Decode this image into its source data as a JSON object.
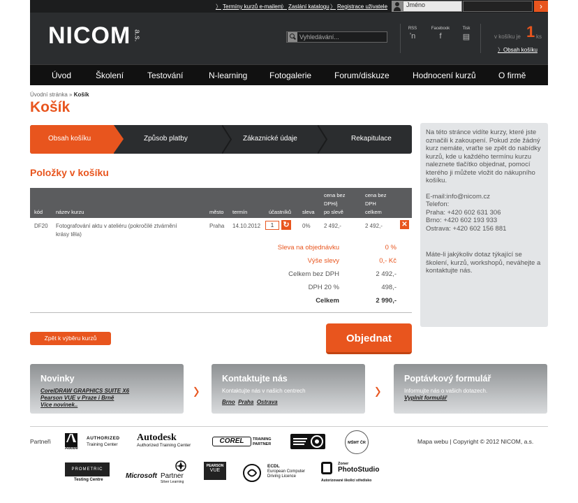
{
  "topbar": {
    "links": [
      "Termíny kurzů e-mailem",
      "Zaslání katalogu",
      "Registrace uživatele"
    ],
    "user_placeholder": "Jméno",
    "login_arrow": "›"
  },
  "header": {
    "logo": "NICOM",
    "logo_suffix": "a.s.",
    "search_placeholder": "Vyhledávání...",
    "social": [
      {
        "label": "RSS",
        "icon": "rss-icon",
        "glyph": "⌁"
      },
      {
        "label": "Facebook",
        "icon": "facebook-icon",
        "glyph": "f"
      },
      {
        "label": "Tisk",
        "icon": "print-icon",
        "glyph": "▤"
      }
    ],
    "cart_prefix": "v košíku je",
    "cart_count": "1",
    "cart_suffix": "ks",
    "cart_link": "Obsah košíku"
  },
  "nav": [
    "Úvod",
    "Školení",
    "Testování",
    "N-learning",
    "Fotogalerie",
    "Forum/diskuze",
    "Hodnocení kurzů",
    "O firmě"
  ],
  "breadcrumb": {
    "home": "Úvodní stránka",
    "separator": "»",
    "current": "Košík"
  },
  "page_title": "Košík",
  "steps": [
    "Obsah košíku",
    "Způsob platby",
    "Zákaznické údaje",
    "Rekapitulace"
  ],
  "items_heading": "Položky v košíku",
  "table": {
    "headers": {
      "code": "kód",
      "name": "název kurzu",
      "city": "město",
      "date": "termín",
      "participants": "účastníků",
      "discount": "sleva",
      "price_after_1": "cena bez",
      "price_after_2": "DPH/j",
      "price_after_3": "po slevě",
      "total_1": "cena bez",
      "total_2": "DPH",
      "total_3": "celkem"
    },
    "row": {
      "code": "DF20",
      "name_1": "Fotografování aktu v ateliéru (pokročilé ztvárnění",
      "name_2": "krásy těla)",
      "city": "Praha",
      "date": "14.10.2012",
      "qty": "1",
      "discount": "0%",
      "price": "2 492,-",
      "total": "2 492,-"
    }
  },
  "summary": [
    {
      "label": "Sleva na objednávku",
      "value": "0 %",
      "color": "#e8551e"
    },
    {
      "label": "Výše slevy",
      "value": "0,- Kč",
      "color": "#e8551e"
    },
    {
      "label": "Celkem bez DPH",
      "value": "2 492,-",
      "color": "#555"
    },
    {
      "label": "DPH 20 %",
      "value": "498,-",
      "color": "#555"
    },
    {
      "label": "Celkem",
      "value": "2 990,-",
      "color": "#333"
    }
  ],
  "back_button": "Zpět k výběru kurzů",
  "order_button": "Objednat",
  "sidebar": {
    "intro": "Na této stránce vidíte kurzy, které jste označili k zakoupení. Pokud zde žádný kurz nemáte, vraťte se zpět do nabídky kurzů, kde u každého termínu kurzu naleznete tlačítko objednat, pomocí kterého ji můžete vložit do nákupního košíku.",
    "contacts": "E-mail:info@nicom.cz\nTelefon:\nPraha: +420 602 631 306\nBrno: +420 602 193 933\nOstrava: +420 602 156 881",
    "footer": "Máte-li jakýkoliv dotaz týkající se školení, kurzů, workshopů, neváhejte a kontaktujte nás."
  },
  "boxes": {
    "news": {
      "title": "Novinky",
      "items": [
        "CorelDRAW GRAPHICS SUITE X6",
        "Pearson VUE v Praze i Brně",
        "Více novinek.."
      ]
    },
    "contact": {
      "title": "Kontaktujte nás",
      "text": "Kontaktujte nás v našich centrech",
      "links": [
        "Brno",
        "Praha",
        "Ostrava"
      ]
    },
    "inquiry": {
      "title": "Poptávkový formulář",
      "text": "Informujte nás o vašich dotazech.",
      "link": "Vyplnit formulář"
    }
  },
  "footer": {
    "partners_label": "Partneři",
    "right": "Mapa webu | Copyright © 2012 NICOM, a.s.",
    "partners": {
      "adobe_1": "AUTHORIZED",
      "adobe_2": "Training Center",
      "adobe_logo": "Adobe",
      "autodesk": "Autodesk",
      "autodesk_sub": "Authorized Training Center",
      "corel": "COREL",
      "corel_sub_1": "TRAINING",
      "corel_sub_2": "PARTNER",
      "msmt": "MŠMT ČR",
      "prometric": "PROMETRIC",
      "prometric_sub": "Testing Centre",
      "microsoft": "Microsoft",
      "microsoft_2": "Partner",
      "microsoft_sub": "Silver Learning",
      "pearson": "PEARSON",
      "pearson_sub": "VUE",
      "ecdl_1": "ECDL",
      "ecdl_2": "European Computer",
      "ecdl_3": "Driving Licence",
      "zoner_1": "Zoner",
      "zoner_2": "PhotoStudio",
      "zoner_sub": "Autorizované školicí středisko"
    }
  }
}
